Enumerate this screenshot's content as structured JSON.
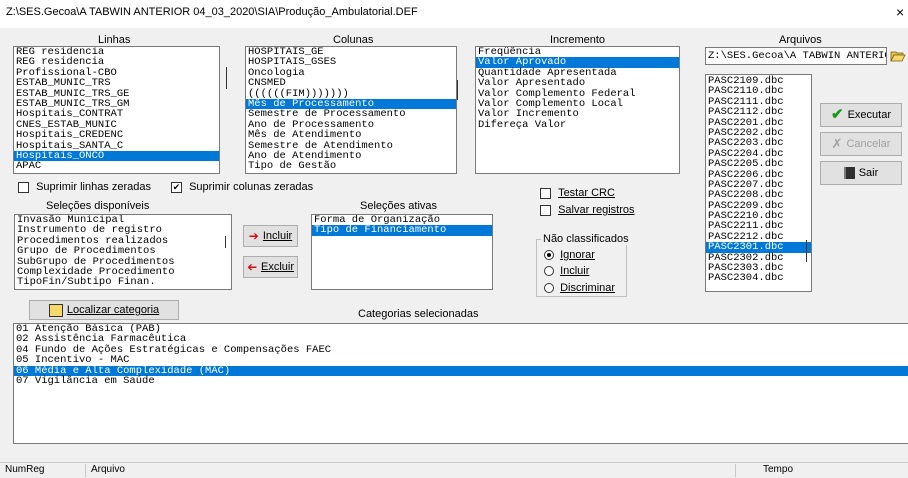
{
  "window": {
    "title": "Z:\\SES.Gecoa\\A TABWIN ANTERIOR 04_03_2020\\SIA\\Produção_Ambulatorial.DEF",
    "close": "×"
  },
  "headers": {
    "linhas": "Linhas",
    "colunas": "Colunas",
    "incremento": "Incremento",
    "arquivos": "Arquivos"
  },
  "linhas": [
    "REG residencia",
    "REG residencia",
    "Profissional-CBO",
    "ESTAB_MUNIC_TRS",
    "ESTAB_MUNIC_TRS_GE",
    "ESTAB_MUNIC_TRS_GM",
    "Hospitais_CONTRAT",
    "CNES_ESTAB_MUNIC",
    "Hospitais_CREDENC",
    "Hospitais_SANTA_C",
    "Hospitais_ONCO",
    "APAC"
  ],
  "colunas": [
    "HOSPITAIS_GE",
    "HOSPITAIS_GSES",
    "Oncologia",
    "CNSMED",
    "((((((FIM)))))))",
    "Mês de Processamento",
    "Semestre de Processamento",
    "Ano de Processamento",
    "Mês de Atendimento",
    "Semestre de Atendimento",
    "Ano de Atendimento",
    "Tipo de Gestão"
  ],
  "incremento": [
    "Freqüência",
    "Valor Aprovado",
    "Quantidade Apresentada",
    "Valor Apresentado",
    "Valor Complemento Federal",
    "Valor Complemento Local",
    "Valor Incremento",
    "Difereça Valor"
  ],
  "arquivos": {
    "path": "Z:\\SES.Gecoa\\A TABWIN ANTERIOR",
    "files": [
      "PASC2109.dbc",
      "PASC2110.dbc",
      "PASC2111.dbc",
      "PASC2112.dbc",
      "PASC2201.dbc",
      "PASC2202.dbc",
      "PASC2203.dbc",
      "PASC2204.dbc",
      "PASC2205.dbc",
      "PASC2206.dbc",
      "PASC2207.dbc",
      "PASC2208.dbc",
      "PASC2209.dbc",
      "PASC2210.dbc",
      "PASC2211.dbc",
      "PASC2212.dbc",
      "PASC2301.dbc",
      "PASC2302.dbc",
      "PASC2303.dbc",
      "PASC2304.dbc"
    ]
  },
  "buttons": {
    "executar": "Executar",
    "cancelar": "Cancelar",
    "sair": "Sair",
    "incluir": "Incluir",
    "excluir": "Excluir",
    "localizar": "Localizar categoria"
  },
  "checks": {
    "suprimir_linhas": "Suprimir linhas zeradas",
    "suprimir_colunas": "Suprimir colunas zeradas",
    "testar_crc": "Testar CRC",
    "salvar_registros": "Salvar registros"
  },
  "selecoes_disponiveis": {
    "label": "Seleções disponíveis",
    "items": [
      "Invasão Municipal",
      "Instrumento de registro",
      "Procedimentos realizados",
      "Grupo de Procedimentos",
      "SubGrupo de Procedimentos",
      "Complexidade Procedimento",
      "TipoFin/Subtipo Finan."
    ]
  },
  "selecoes_ativas": {
    "label": "Seleções ativas",
    "items": [
      "Forma de Organização",
      "Tipo de Financiamento"
    ]
  },
  "nao_classificados": {
    "label": "Não classificados",
    "options": [
      "Ignorar",
      "Incluir",
      "Discriminar"
    ]
  },
  "categorias": {
    "label": "Categorias selecionadas",
    "items": [
      "01 Atenção Básica (PAB)",
      "02 Assistência Farmacêutica",
      "04 Fundo de Ações Estratégicas e Compensações FAEC",
      "05 Incentivo - MAC",
      "06 Média e Alta Complexidade (MAC)",
      "07 Vigilância em Saúde"
    ]
  },
  "status": {
    "numreg": "NumReg",
    "arquivo": "Arquivo",
    "tempo": "Tempo"
  }
}
